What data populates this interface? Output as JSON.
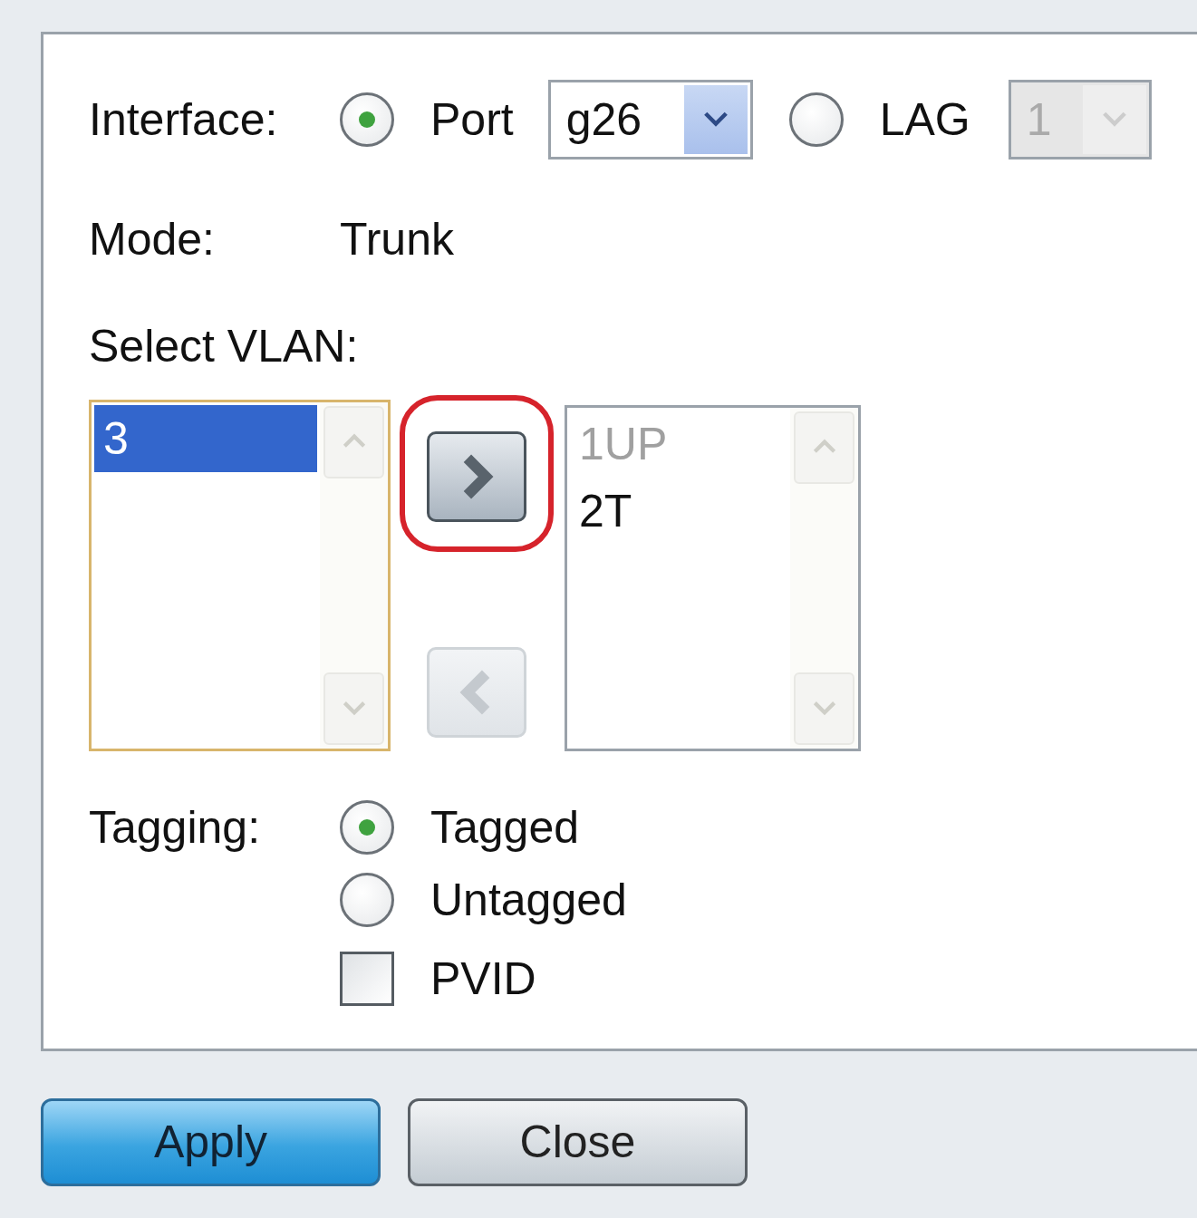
{
  "interface": {
    "label": "Interface:",
    "options": [
      {
        "label": "Port",
        "selected": true,
        "select": {
          "value": "g26",
          "disabled": false
        }
      },
      {
        "label": "LAG",
        "selected": false,
        "select": {
          "value": "1",
          "disabled": true
        }
      }
    ]
  },
  "mode": {
    "label": "Mode:",
    "value": "Trunk"
  },
  "select_vlan": {
    "label": "Select VLAN:",
    "available": [
      {
        "label": "3",
        "selected": true
      }
    ],
    "assigned": [
      {
        "label": "1UP",
        "disabled": true
      },
      {
        "label": "2T",
        "disabled": false
      }
    ],
    "add_button": {
      "highlighted": true,
      "disabled": false
    },
    "remove_button": {
      "disabled": true
    }
  },
  "tagging": {
    "label": "Tagging:",
    "options": [
      {
        "kind": "radio",
        "label": "Tagged",
        "checked": true
      },
      {
        "kind": "radio",
        "label": "Untagged",
        "checked": false
      },
      {
        "kind": "checkbox",
        "label": "PVID",
        "checked": false
      }
    ]
  },
  "buttons": [
    {
      "label": "Apply",
      "kind": "primary"
    },
    {
      "label": "Close",
      "kind": "secondary"
    }
  ]
}
